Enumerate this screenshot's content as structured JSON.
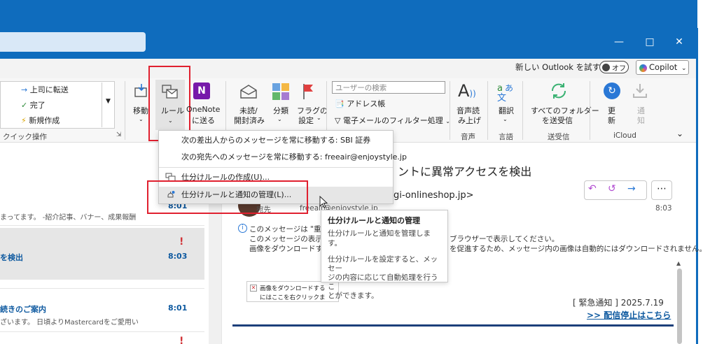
{
  "top_strip": {
    "new_outlook_label": "新しい Outlook を試す",
    "toggle_label": "オフ",
    "copilot_label": "Copilot"
  },
  "quick_steps": {
    "items": [
      "上司に転送",
      "完了",
      "新規作成"
    ],
    "group_label": "クイック操作"
  },
  "ribbon": {
    "move_label": "移動",
    "rules_label": "ルール",
    "onenote_label1": "OneNote",
    "onenote_label2": "に送る",
    "unread_label1": "未読/",
    "unread_label2": "開封済み",
    "categorize_label": "分類",
    "flag_label1": "フラグの",
    "flag_label2": "設定",
    "search_users_placeholder": "ユーザーの検索",
    "address_book_label": "アドレス帳",
    "filter_label": "電子メールのフィルター処理",
    "read_aloud_label1": "音声読",
    "read_aloud_label2": "み上げ",
    "voice_group": "音声",
    "translate_label": "翻訳",
    "language_group": "言語",
    "sendrecv_label1": "すべてのフォルダー",
    "sendrecv_label2": "を送受信",
    "sendrecv_group": "送受信",
    "refresh_label1": "更",
    "refresh_label2": "新",
    "notify_label1": "通",
    "notify_label2": "知",
    "icloud_group": "iCloud"
  },
  "rules_menu": {
    "items": [
      "次の差出人からのメッセージを常に移動する: SBI 証券",
      "次の宛先へのメッセージを常に移動する: freeair@enjoystyle.jp",
      "仕分けルールの作成(U)...",
      "仕分けルールと通知の管理(L)..."
    ]
  },
  "tooltip": {
    "title": "仕分けルールと通知の管理",
    "line1": "仕分けルールと通知を管理します。",
    "line2a": "仕分けルールを設定すると、メッセー",
    "line2b": "ジの内容に応じて自動処理を行うこ",
    "line2c": "とができます。"
  },
  "mail_list": {
    "row0_time": "8:01",
    "row0_preview": "まってます。 -紹介記事、バナー、成果報酬",
    "row1_subject": "を検出",
    "row1_time": "8:03",
    "row2_subject": "続きのご案内",
    "row2_time": "8:01",
    "row2_preview": "ざいます。 日頃よりMastercardをご愛用い"
  },
  "reading_pane": {
    "subject_fragment": "ントに異常アクセスを検出",
    "sender_fragment": "gi-onlineshop.jp>",
    "to_label": "宛先",
    "to_value": "freeair@enjoystyle.jp",
    "time": "8:03",
    "info_line1": "このメッセージは \"重要\"",
    "info_line2": "このメッセージの表示に",
    "info_line2b": "ブラウザーで表示してください。",
    "info_line3": "画像をダウンロードする",
    "info_line3b": "を促進するため、メッセージ内の画像は自動的にはダウンロードされません。",
    "image_placeholder1": "画像をダウンロードする",
    "image_placeholder2": "にはここを右クリックま",
    "emergency": "[ 緊急通知 ] 2025.7.19",
    "unsubscribe": ">> 配信停止はこちら"
  }
}
